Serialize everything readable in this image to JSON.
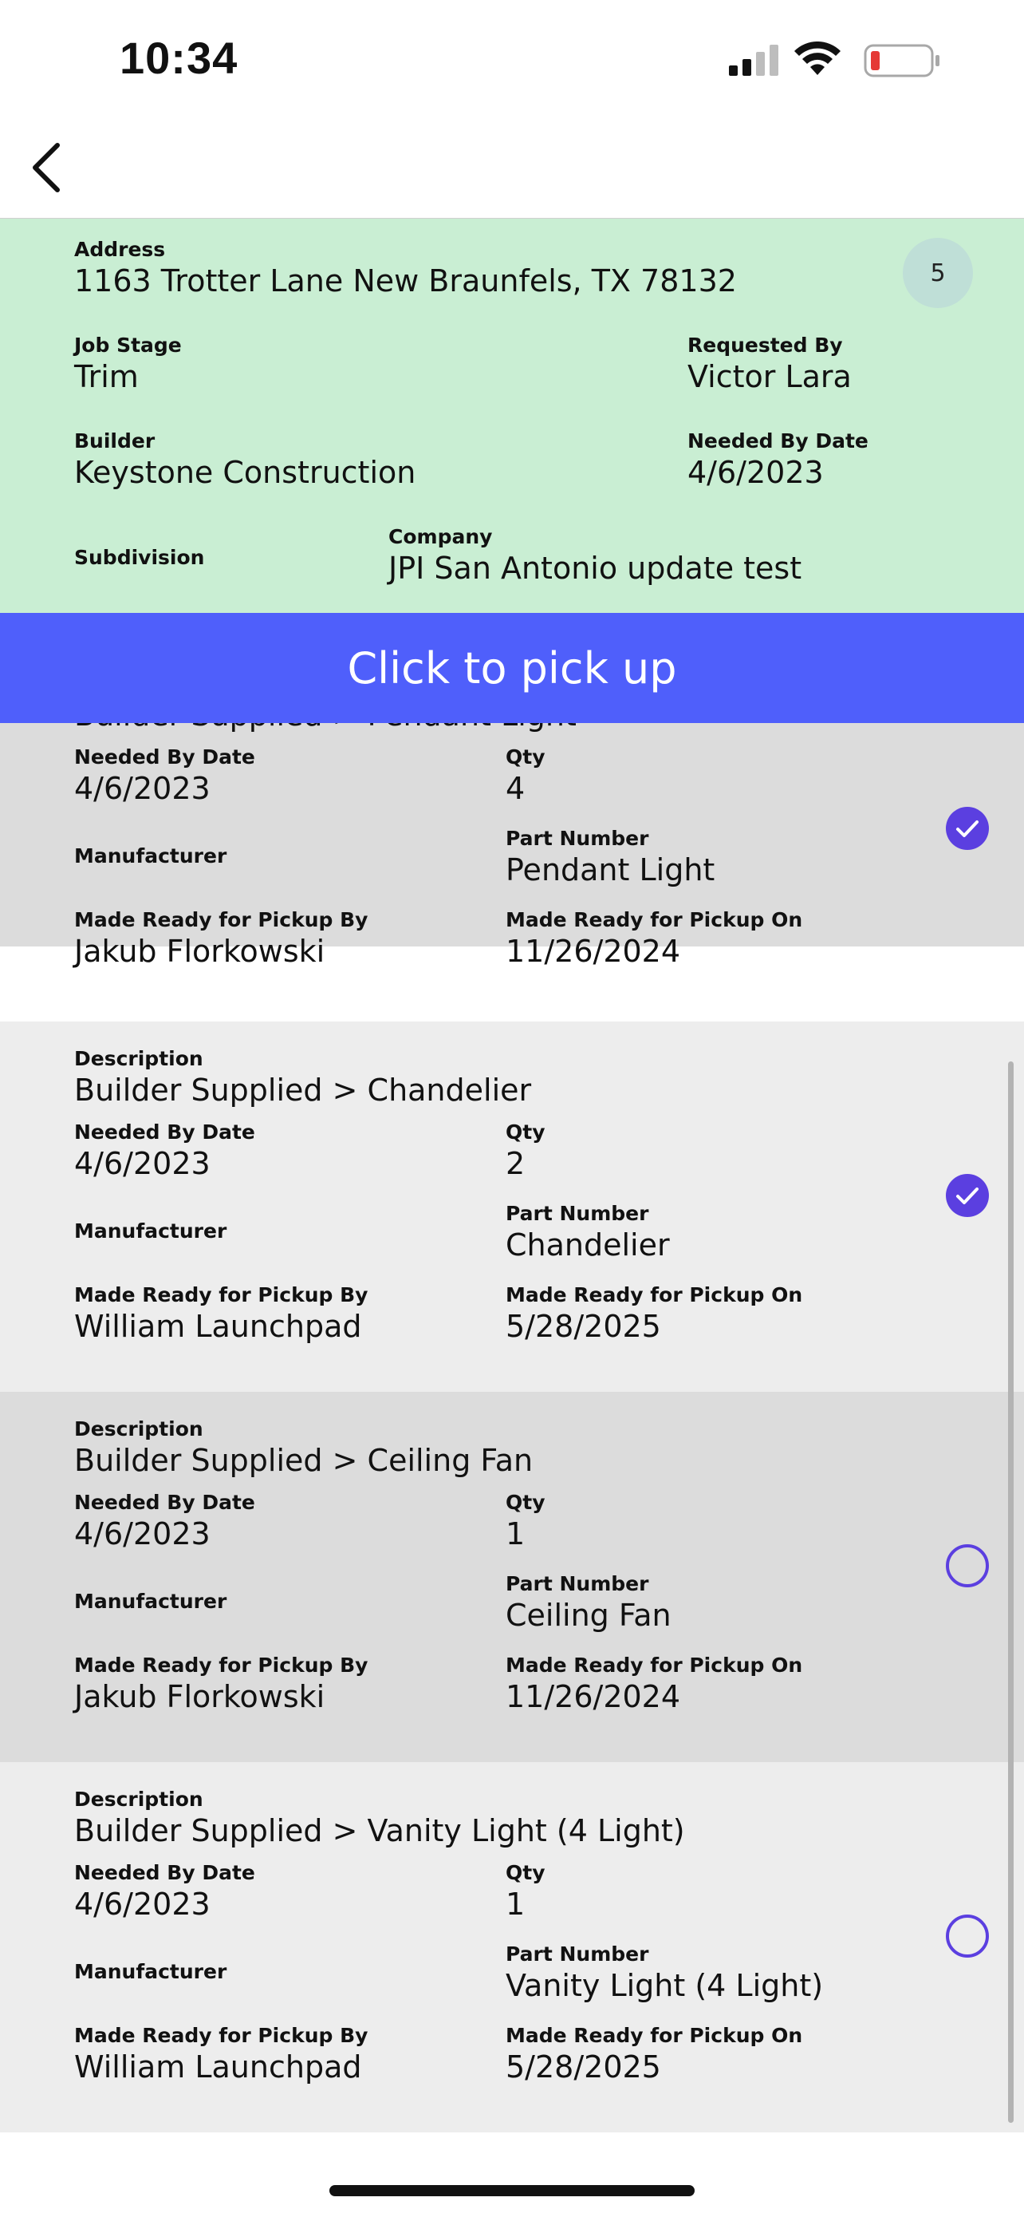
{
  "status_bar": {
    "time": "10:34"
  },
  "job": {
    "badge_count": "5",
    "address_label": "Address",
    "address": "1163 Trotter Lane New Braunfels, TX 78132",
    "job_stage_label": "Job Stage",
    "job_stage": "Trim",
    "requested_by_label": "Requested By",
    "requested_by": "Victor Lara",
    "builder_label": "Builder",
    "builder": "Keystone Construction",
    "needed_by_label": "Needed By Date",
    "needed_by": "4/6/2023",
    "subdivision_label": "Subdivision",
    "company_label": "Company",
    "company": "JPI San Antonio update test"
  },
  "pickup_button": "Click to pick up",
  "labels": {
    "description": "Description",
    "needed_by": "Needed By Date",
    "qty": "Qty",
    "manufacturer": "Manufacturer",
    "part_number": "Part Number",
    "ready_by": "Made Ready for Pickup By",
    "ready_on": "Made Ready for Pickup On"
  },
  "items": [
    {
      "description": "Builder Supplied  > Pendant Light",
      "needed_by": "4/6/2023",
      "qty": "4",
      "part_number": "Pendant Light",
      "ready_by": "Jakub Florkowski",
      "ready_on": "11/26/2024",
      "checked": true
    },
    {
      "description": "Builder Supplied  > Chandelier",
      "needed_by": "4/6/2023",
      "qty": "2",
      "part_number": "Chandelier",
      "ready_by": "William Launchpad",
      "ready_on": "5/28/2025",
      "checked": true
    },
    {
      "description": "Builder Supplied  > Ceiling Fan",
      "needed_by": "4/6/2023",
      "qty": "1",
      "part_number": "Ceiling Fan",
      "ready_by": "Jakub Florkowski",
      "ready_on": "11/26/2024",
      "checked": false
    },
    {
      "description": "Builder Supplied  > Vanity Light  (4 Light)",
      "needed_by": "4/6/2023",
      "qty": "1",
      "part_number": "Vanity Light (4 Light)",
      "ready_by": "William Launchpad",
      "ready_on": "5/28/2025",
      "checked": false
    }
  ],
  "colors": {
    "accent": "#5b3fe0",
    "job_bg": "#c9eed3",
    "pickup_bg": "#4f5ffb"
  }
}
